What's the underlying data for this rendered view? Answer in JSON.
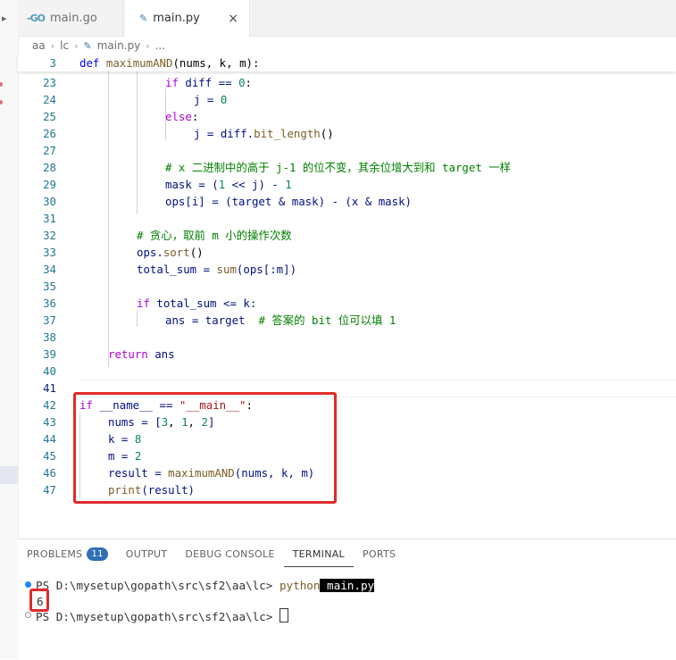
{
  "tabs": [
    {
      "label": "main.go",
      "icon": "go-file-icon",
      "active": false
    },
    {
      "label": "main.py",
      "icon": "python-file-icon",
      "active": true,
      "close": "×"
    }
  ],
  "breadcrumb": [
    "aa",
    "lc",
    "main.py",
    "..."
  ],
  "code_lines": [
    {
      "n": "3"
    },
    {
      "n": "23"
    },
    {
      "n": "24"
    },
    {
      "n": "25"
    },
    {
      "n": "26"
    },
    {
      "n": "27"
    },
    {
      "n": "28"
    },
    {
      "n": "29"
    },
    {
      "n": "30"
    },
    {
      "n": "31"
    },
    {
      "n": "32"
    },
    {
      "n": "33"
    },
    {
      "n": "34"
    },
    {
      "n": "35"
    },
    {
      "n": "36"
    },
    {
      "n": "37"
    },
    {
      "n": "38"
    },
    {
      "n": "39"
    },
    {
      "n": "40"
    },
    {
      "n": "41"
    },
    {
      "n": "42"
    },
    {
      "n": "43"
    },
    {
      "n": "44"
    },
    {
      "n": "45"
    },
    {
      "n": "46"
    },
    {
      "n": "47"
    }
  ],
  "code": {
    "l3": [
      "def",
      " ",
      "maximumAND",
      "(nums, k, m):"
    ],
    "l23": [
      "if",
      " diff == ",
      "0",
      ":"
    ],
    "l24": [
      "j = ",
      "0"
    ],
    "l25": [
      "else",
      ":"
    ],
    "l26": [
      "j = diff.",
      "bit_length",
      "()"
    ],
    "l28": "# x 二进制中的高于 j-1 的位不变，其余位增大到和 target 一样",
    "l29": [
      "mask = (",
      "1",
      " << j) - ",
      "1"
    ],
    "l30": "ops[i] = (target & mask) - (x & mask)",
    "l32": "# 贪心，取前 m 小的操作次数",
    "l33": [
      "ops.",
      "sort",
      "()"
    ],
    "l34": [
      "total_sum = ",
      "sum",
      "(ops[:m])"
    ],
    "l36": [
      "if",
      " total_sum <= k:"
    ],
    "l37_code": "ans = target  ",
    "l37_comment": "# 答案的 bit 位可以填 1",
    "l39": [
      "return",
      " ans"
    ],
    "l42": [
      "if",
      " __name__ == ",
      "\"__main__\"",
      ":"
    ],
    "l43": [
      "nums = [",
      "3",
      ", ",
      "1",
      ", ",
      "2",
      "]"
    ],
    "l44": [
      "k = ",
      "8"
    ],
    "l45": [
      "m = ",
      "2"
    ],
    "l46": [
      "result = ",
      "maximumAND",
      "(nums, k, m)"
    ],
    "l47": [
      "print",
      "(result)"
    ]
  },
  "panel": {
    "tabs": [
      {
        "label": "PROBLEMS",
        "badge": "11"
      },
      {
        "label": "OUTPUT"
      },
      {
        "label": "DEBUG CONSOLE"
      },
      {
        "label": "TERMINAL",
        "active": true
      },
      {
        "label": "PORTS"
      }
    ]
  },
  "terminal": {
    "prompt1": "PS D:\\mysetup\\gopath\\src\\sf2\\aa\\lc> ",
    "command": "python",
    "arg": " main.py",
    "output": "6",
    "prompt2": "PS D:\\mysetup\\gopath\\src\\sf2\\aa\\lc> "
  },
  "colors": {
    "highlight_box": "#e02b2b",
    "line_number": "#237893",
    "badge": "#2f6fb6"
  }
}
